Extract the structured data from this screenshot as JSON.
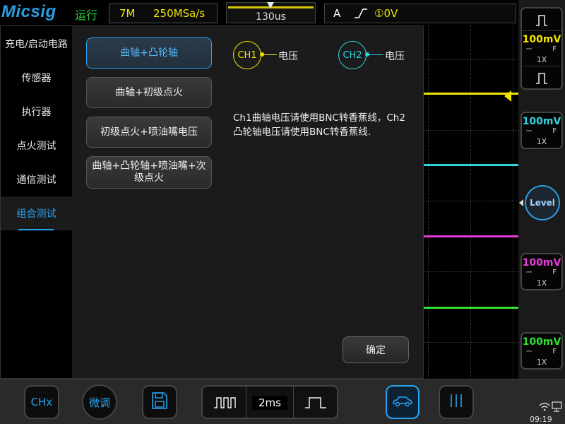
{
  "topbar": {
    "logo": "Micsig",
    "run_state": "运行",
    "memory_depth": "7M",
    "sample_rate": "250MSa/s",
    "timebase_position": "130us",
    "trigger_source": "A",
    "trigger_edge": "⎍",
    "trigger_channel_mark": "①",
    "trigger_level": "0V"
  },
  "left_nav": {
    "items": [
      {
        "label": "充电/启动电路",
        "active": false
      },
      {
        "label": "传感器",
        "active": false
      },
      {
        "label": "执行器",
        "active": false
      },
      {
        "label": "点火测试",
        "active": false
      },
      {
        "label": "通信测试",
        "active": false
      },
      {
        "label": "组合测试",
        "active": true
      }
    ]
  },
  "options": [
    {
      "label": "曲轴+凸轮轴",
      "active": true
    },
    {
      "label": "曲轴+初级点火",
      "active": false
    },
    {
      "label": "初级点火+喷油嘴电压",
      "active": false
    },
    {
      "label": "曲轴+凸轮轴+喷油嘴+次级点火",
      "active": false
    }
  ],
  "channels_legend": [
    {
      "label": "CH1",
      "lead_text": "电压",
      "color": "#f2e600"
    },
    {
      "label": "CH2",
      "lead_text": "电压",
      "color": "#2fd3de"
    }
  ],
  "note": "Ch1曲轴电压请使用BNC转香蕉线，Ch2凸轮轴电压请使用BNC转香蕉线.",
  "confirm_label": "确定",
  "right_panel": {
    "channels": [
      {
        "volts": "100mV",
        "coupling": "⎓",
        "bw": "F",
        "probe": "1X",
        "color": "#f2e600"
      },
      {
        "volts": "100mV",
        "coupling": "⎓",
        "bw": "F",
        "probe": "1X",
        "color": "#2fd3de"
      },
      {
        "volts": "100mV",
        "coupling": "⎓",
        "bw": "F",
        "probe": "1X",
        "color": "#e83ad8"
      },
      {
        "volts": "100mV",
        "coupling": "⎓",
        "bw": "F",
        "probe": "1X",
        "color": "#2fe02f"
      }
    ],
    "level_label": "Level"
  },
  "bottombar": {
    "chx_label": "CHx",
    "fine_label": "微调",
    "time_div": "2ms",
    "clock": "09:19"
  },
  "colors": {
    "accent": "#2aa3f0",
    "ch1": "#f2e600",
    "ch2": "#2fd3de",
    "ch3": "#e83ad8",
    "ch4": "#2fe02f"
  }
}
